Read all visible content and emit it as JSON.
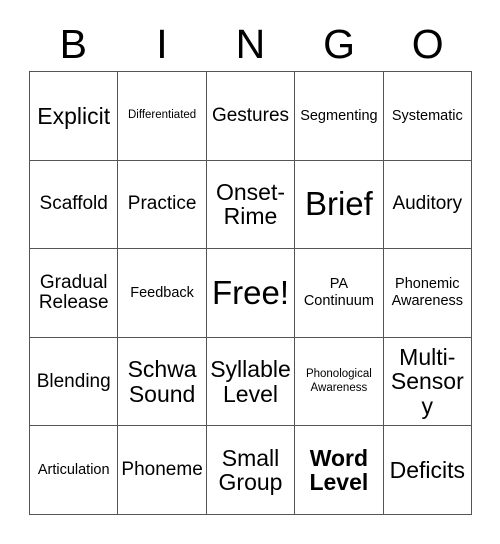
{
  "header": {
    "letters": [
      "B",
      "I",
      "N",
      "G",
      "O"
    ]
  },
  "grid": {
    "rows": 5,
    "columns": 5,
    "border_color": "#555555",
    "background_color": "#ffffff",
    "text_color": "#000000",
    "cells": [
      {
        "text": "Explicit",
        "size": "lg",
        "bold": false
      },
      {
        "text": "Differentiated",
        "size": "xs",
        "bold": false
      },
      {
        "text": "Gestures",
        "size": "md",
        "bold": false
      },
      {
        "text": "Segmenting",
        "size": "sm",
        "bold": false
      },
      {
        "text": "Systematic",
        "size": "sm",
        "bold": false
      },
      {
        "text": "Scaffold",
        "size": "md",
        "bold": false
      },
      {
        "text": "Practice",
        "size": "md",
        "bold": false
      },
      {
        "text": "Onset-\nRime",
        "size": "lg",
        "bold": false
      },
      {
        "text": "Brief",
        "size": "xxl",
        "bold": false
      },
      {
        "text": "Auditory",
        "size": "md",
        "bold": false
      },
      {
        "text": "Gradual\nRelease",
        "size": "md",
        "bold": false
      },
      {
        "text": "Feedback",
        "size": "sm",
        "bold": false
      },
      {
        "text": "Free!",
        "size": "xxl",
        "bold": false
      },
      {
        "text": "PA\nContinuum",
        "size": "sm",
        "bold": false
      },
      {
        "text": "Phonemic\nAwareness",
        "size": "sm",
        "bold": false
      },
      {
        "text": "Blending",
        "size": "md",
        "bold": false
      },
      {
        "text": "Schwa\nSound",
        "size": "lg",
        "bold": false
      },
      {
        "text": "Syllable\nLevel",
        "size": "lg",
        "bold": false
      },
      {
        "text": "Phonological\nAwareness",
        "size": "xs",
        "bold": false
      },
      {
        "text": "Multi-\nSensory",
        "size": "lg",
        "bold": false
      },
      {
        "text": "Articulation",
        "size": "sm",
        "bold": false
      },
      {
        "text": "Phoneme",
        "size": "md",
        "bold": false
      },
      {
        "text": "Small\nGroup",
        "size": "lg",
        "bold": false
      },
      {
        "text": "Word\nLevel",
        "size": "lg",
        "bold": true
      },
      {
        "text": "Deficits",
        "size": "lg",
        "bold": false
      }
    ]
  }
}
